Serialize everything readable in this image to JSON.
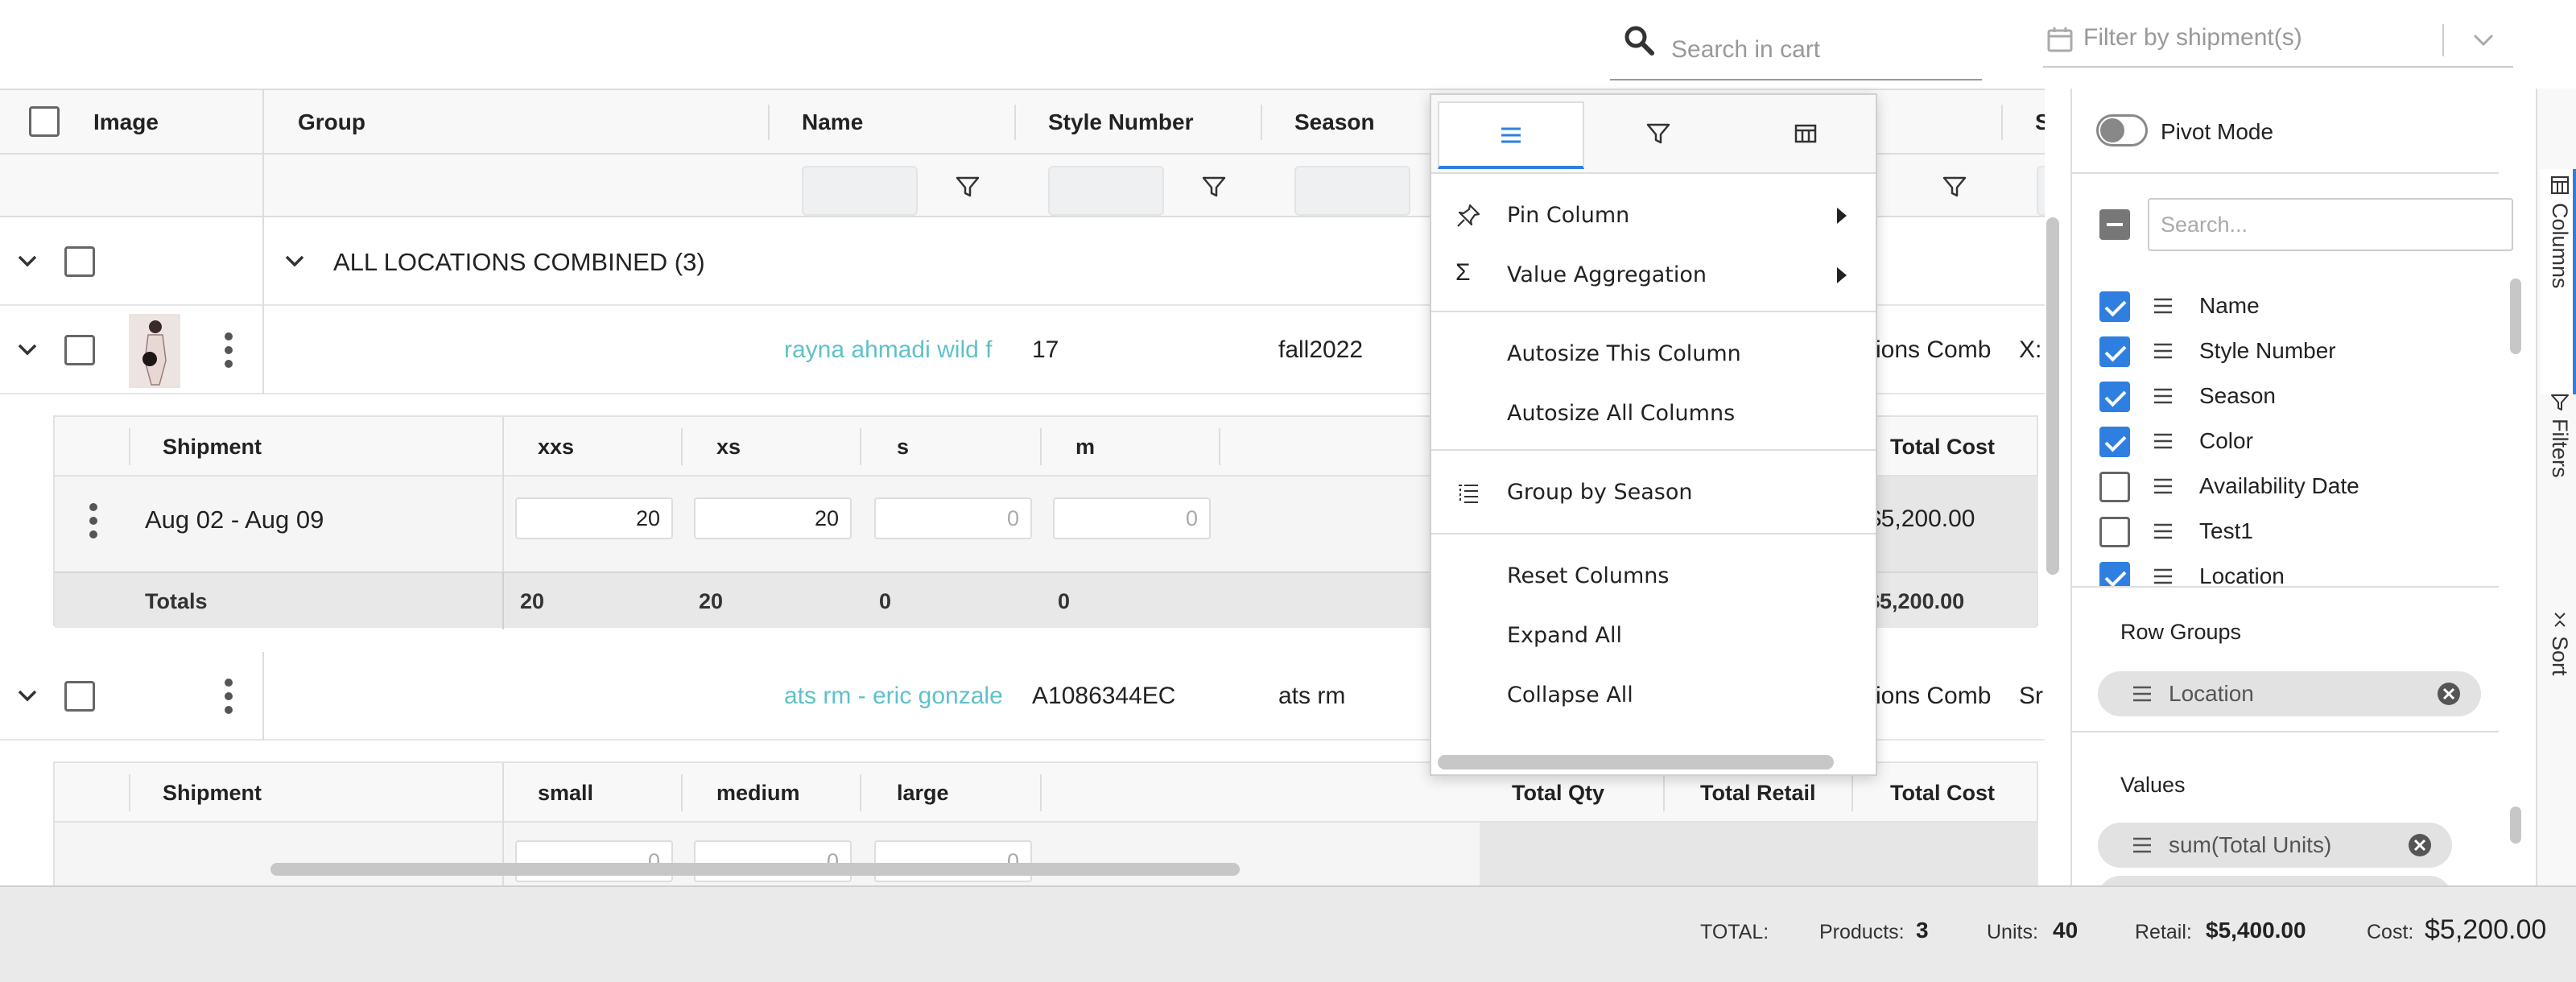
{
  "search": {
    "placeholder": "Search in cart"
  },
  "shipment_filter": {
    "placeholder": "Filter by shipment(s)"
  },
  "grid": {
    "columns": [
      "Image",
      "Group",
      "Name",
      "Style Number",
      "Season"
    ],
    "right_header_partial": "Size",
    "group_row": {
      "label": "ALL LOCATIONS COMBINED (3)"
    },
    "rows": [
      {
        "name": "rayna ahmadi wild f",
        "style_number": "17",
        "season": "fall2022",
        "location": "ions Comb",
        "size_partial": "X:",
        "detail": {
          "headers": [
            "Shipment",
            "xxs",
            "xs",
            "s",
            "m",
            "Total Cost"
          ],
          "shipment": "Aug 02 - Aug 09",
          "quantities": [
            "20",
            "20",
            "0",
            "0"
          ],
          "total_cost": "$5,200.00",
          "totals_label": "Totals",
          "totals": [
            "20",
            "20",
            "0",
            "0"
          ],
          "totals_cost": "$5,200.00"
        }
      },
      {
        "name": "ats rm - eric gonzale",
        "style_number": "A1086344EC",
        "season": "ats rm",
        "location": "ions Comb",
        "size_partial": "Sr",
        "detail": {
          "headers": [
            "Shipment",
            "small",
            "medium",
            "large",
            "Total Qty",
            "Total Retail",
            "Total Cost"
          ],
          "quantities": [
            "0",
            "0",
            "0"
          ]
        }
      }
    ]
  },
  "column_menu": {
    "items": [
      {
        "label": "Pin Column",
        "icon": "pin-icon",
        "submenu": true
      },
      {
        "label": "Value Aggregation",
        "icon": "sigma-icon",
        "submenu": true
      },
      {
        "label": "Autosize This Column"
      },
      {
        "label": "Autosize All Columns"
      },
      {
        "label": "Group by Season",
        "icon": "group-icon"
      },
      {
        "label": "Reset Columns"
      },
      {
        "label": "Expand All"
      },
      {
        "label": "Collapse All"
      }
    ]
  },
  "tool_panel": {
    "pivot_mode": "Pivot Mode",
    "search_placeholder": "Search...",
    "columns": [
      {
        "label": "Name",
        "checked": true
      },
      {
        "label": "Style Number",
        "checked": true
      },
      {
        "label": "Season",
        "checked": true
      },
      {
        "label": "Color",
        "checked": true
      },
      {
        "label": "Availability Date",
        "checked": false
      },
      {
        "label": "Test1",
        "checked": false
      },
      {
        "label": "Location",
        "checked": true
      }
    ],
    "row_groups_title": "Row Groups",
    "row_groups": [
      "Location"
    ],
    "values_title": "Values",
    "values": [
      "sum(Total Units)"
    ]
  },
  "side_bar": {
    "tabs": [
      "Columns",
      "Filters",
      "Sort"
    ]
  },
  "footer": {
    "total_label": "TOTAL:",
    "products_label": "Products:",
    "products": "3",
    "units_label": "Units:",
    "units": "40",
    "retail_label": "Retail:",
    "retail": "$5,400.00",
    "cost_label": "Cost:",
    "cost": "$5,200.00"
  },
  "colors": {
    "accent": "#2f7fe0",
    "link": "#5fc1c9"
  }
}
